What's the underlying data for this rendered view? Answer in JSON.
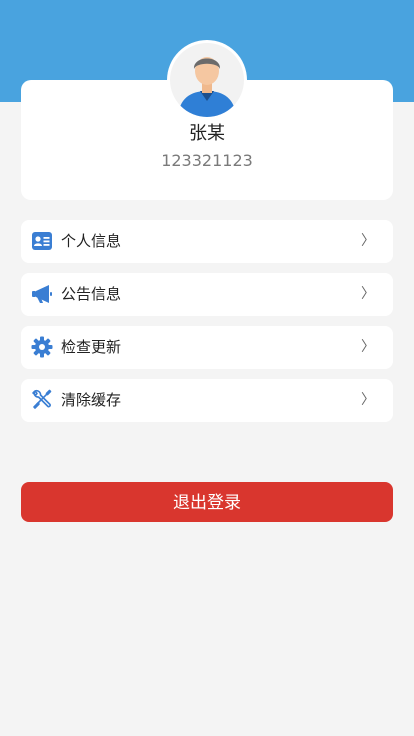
{
  "profile": {
    "name": "张某",
    "id": "123321123"
  },
  "menu": [
    {
      "label": "个人信息",
      "icon": "id-card-icon",
      "chevron": "〉"
    },
    {
      "label": "公告信息",
      "icon": "megaphone-icon",
      "chevron": "〉"
    },
    {
      "label": "检查更新",
      "icon": "gear-icon",
      "chevron": "〉"
    },
    {
      "label": "清除缓存",
      "icon": "wrench-screwdriver-icon",
      "chevron": "〉"
    }
  ],
  "logout": {
    "label": "退出登录"
  },
  "colors": {
    "header": "#49a3df",
    "icon": "#3a7ed3",
    "logout": "#d9362e",
    "background": "#f4f4f4"
  }
}
